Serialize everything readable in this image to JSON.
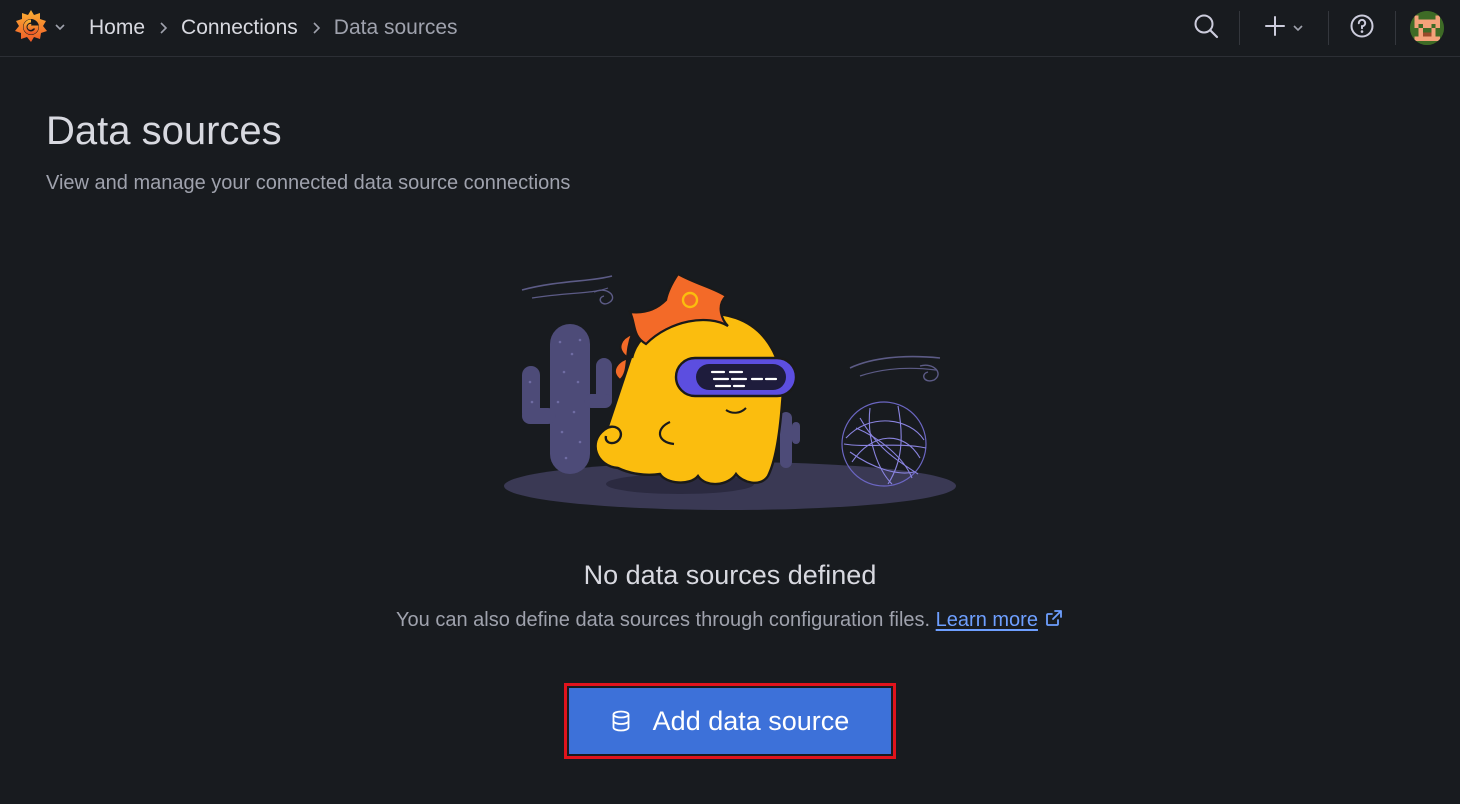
{
  "topbar": {
    "breadcrumbs": [
      {
        "label": "Home"
      },
      {
        "label": "Connections"
      },
      {
        "label": "Data sources"
      }
    ],
    "icons": {
      "logo": "grafana-logo-icon",
      "search": "search-icon",
      "new": "plus-icon",
      "help": "help-icon",
      "profile": "avatar"
    }
  },
  "page": {
    "title": "Data sources",
    "subtitle": "View and manage your connected data source connections"
  },
  "empty_state": {
    "title": "No data sources defined",
    "description": "You can also define data sources through configuration files.",
    "link_label": "Learn more",
    "button_label": "Add data source"
  },
  "colors": {
    "background": "#181b1f",
    "primary_button": "#3d71d9",
    "link": "#6e9fff",
    "highlight_outline": "#e0131c"
  }
}
